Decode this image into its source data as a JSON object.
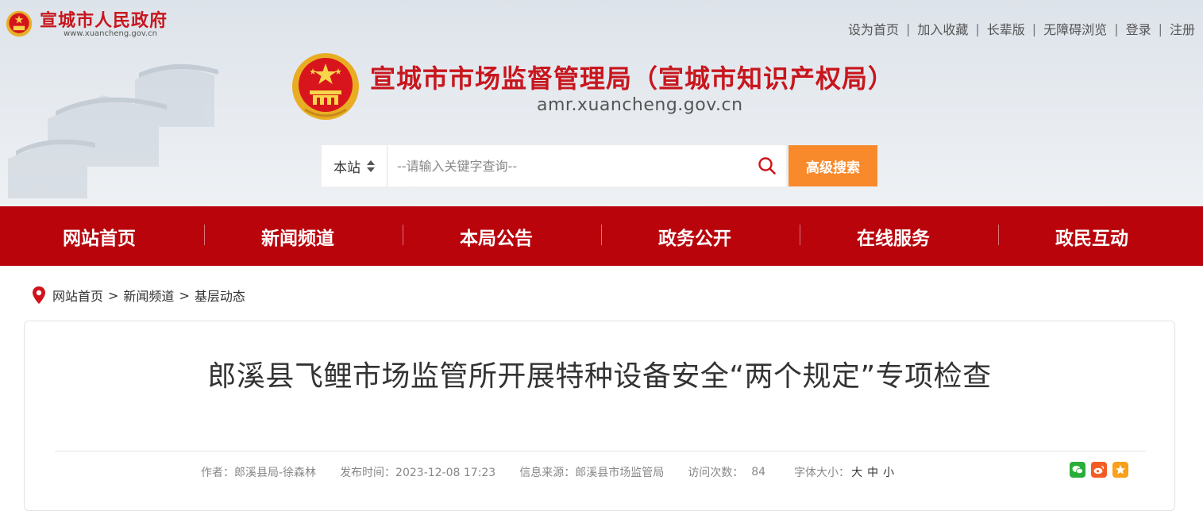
{
  "gov_site": {
    "title": "宣城市人民政府",
    "url": "www.xuancheng.gov.cn"
  },
  "top_links": [
    "设为首页",
    "加入收藏",
    "长辈版",
    "无障碍浏览",
    "登录",
    "注册"
  ],
  "site": {
    "title": "宣城市市场监督管理局（宣城市知识产权局）",
    "url": "amr.xuancheng.gov.cn"
  },
  "search": {
    "scope": "本站",
    "placeholder": "--请输入关键字查询--",
    "advanced_label": "高级搜索"
  },
  "nav": [
    "网站首页",
    "新闻频道",
    "本局公告",
    "政务公开",
    "在线服务",
    "政民互动"
  ],
  "breadcrumb": {
    "items": [
      "网站首页",
      "新闻频道",
      "基层动态"
    ],
    "separator": ">"
  },
  "article": {
    "title": "郎溪县飞鲤市场监管所开展特种设备安全“两个规定”专项检查",
    "author": "作者：郎溪县局-徐森林",
    "publish_time": "发布时间：2023-12-08 17:23",
    "source": "信息来源：郎溪县市场监管局",
    "visits_label": "访问次数：",
    "visits_value": "84",
    "font_size_label": "字体大小：",
    "font_sizes": [
      "大",
      "中",
      "小"
    ]
  },
  "share": [
    "wechat-icon",
    "weibo-icon",
    "favorite-icon"
  ],
  "colors": {
    "brand_red": "#c8161d",
    "nav_red": "#b9040c",
    "accent_orange": "#f98a2c",
    "wechat_green": "#2aae3a",
    "weibo_orange": "#f35c24",
    "favorite_orange": "#f9a11b"
  }
}
